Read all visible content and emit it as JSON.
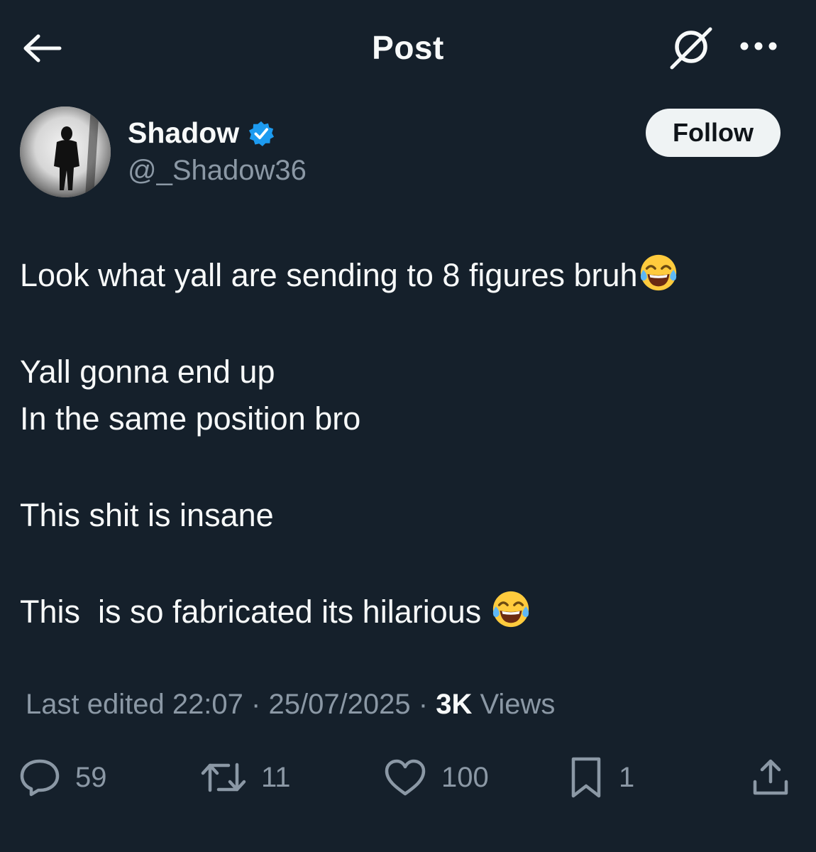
{
  "header": {
    "title": "Post",
    "back_icon": "arrow-left-icon",
    "grok_icon": "grok-icon",
    "more_icon": "more-horizontal-icon"
  },
  "author": {
    "display_name": "Shadow",
    "handle": "@_Shadow36",
    "verified": true,
    "verified_color": "#1d9bf0",
    "follow_label": "Follow"
  },
  "post": {
    "line1": "Look what yall are sending to 8 figures bruh",
    "line2": "Yall gonna end up",
    "line3": "In the same position bro",
    "line4": "This shit is insane",
    "line5": "This  is so fabricated its hilarious ",
    "emoji_icon": "face-with-tears-of-joy-icon"
  },
  "meta": {
    "edited": "Last edited 22:07 · 25/07/2025",
    "separator": " · ",
    "views_count": "3K",
    "views_label": " Views"
  },
  "actions": {
    "replies": "59",
    "reposts": "11",
    "likes": "100",
    "bookmarks": "1"
  },
  "colors": {
    "background": "#15202b",
    "text": "#f7f9f9",
    "secondary": "#8b98a5",
    "follow_bg": "#eff3f4"
  }
}
